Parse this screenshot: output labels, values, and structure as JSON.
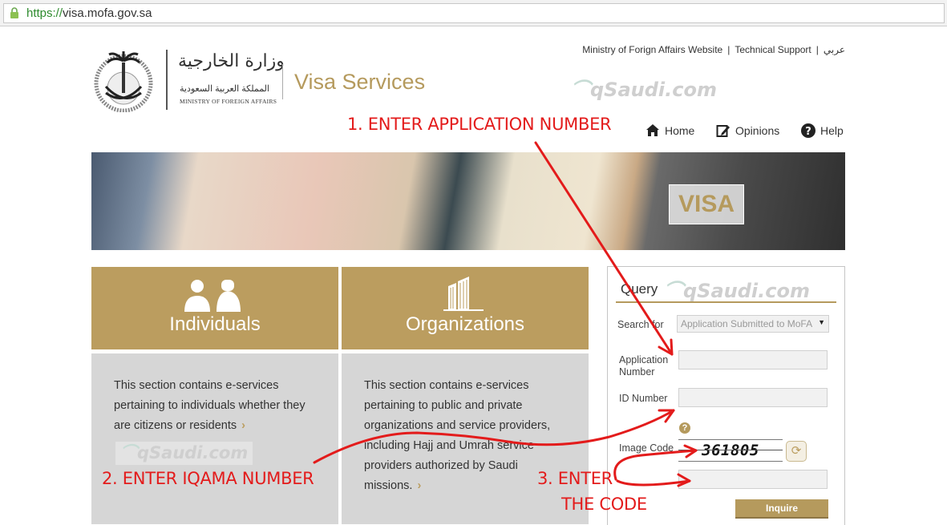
{
  "browser": {
    "url_scheme": "https://",
    "url_host": "visa.mofa.gov.sa",
    "lock_icon": "lock-icon"
  },
  "header": {
    "links": [
      "Ministry of Forign Affairs Website",
      "Technical Support",
      "عربي"
    ],
    "logo_arabic_title": "وزارة الخارجية",
    "logo_arabic_subtitle": "المملكة العربية السعودية",
    "logo_english_subtitle": "MINISTRY OF FOREIGN AFFAIRS",
    "site_title": "Visa Services"
  },
  "nav": {
    "items": [
      {
        "label": "Home",
        "icon": "home-icon"
      },
      {
        "label": "Opinions",
        "icon": "edit-icon"
      },
      {
        "label": "Help",
        "icon": "help-icon"
      }
    ]
  },
  "banner": {
    "visa_text": "VISA"
  },
  "watermark": {
    "text": "qSaudi.com"
  },
  "tiles": [
    {
      "label": "Individuals",
      "icon": "people-icon",
      "description": "This section contains e-services pertaining to individuals whether they are citizens or residents"
    },
    {
      "label": "Organizations",
      "icon": "building-icon",
      "description": "This section contains e-services pertaining to public and private organizations and service providers, including Hajj and Umrah service providers authorized by Saudi missions."
    }
  ],
  "query": {
    "title": "Query",
    "search_for_label": "Search for",
    "search_for_value": "Application Submitted to MoFA",
    "application_number_label": "Application Number",
    "application_number_value": "",
    "id_number_label": "ID Number",
    "id_number_value": "",
    "image_code_label": "Image Code",
    "captcha_text": "361805",
    "code_input_value": "",
    "inquire_label": "Inquire"
  },
  "annotations": {
    "step1": "1. ENTER APPLICATION NUMBER",
    "step2": "2. ENTER IQAMA NUMBER",
    "step3_line1": "3. ENTER",
    "step3_line2": "THE CODE"
  },
  "colors": {
    "gold": "#bb9d5f",
    "annotation_red": "#e31b1b",
    "panel_gray": "#d6d6d6"
  }
}
